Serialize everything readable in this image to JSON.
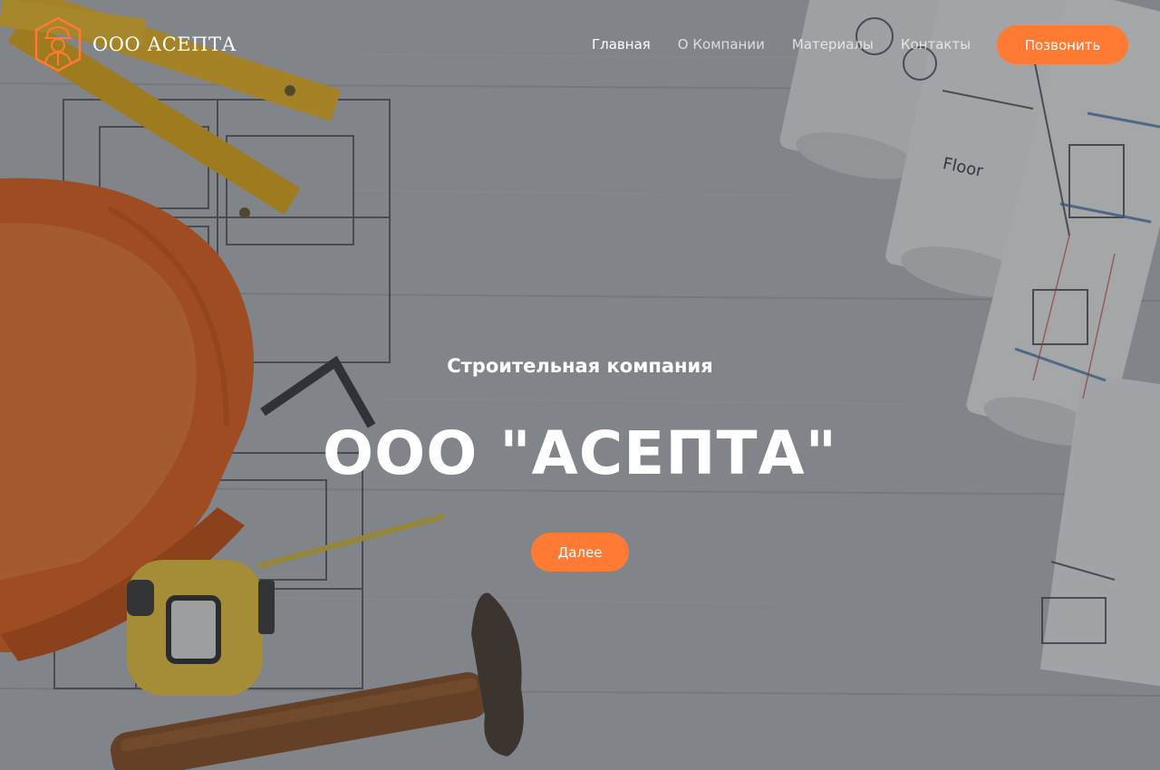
{
  "brand": {
    "name": "ООО АСЕПТА",
    "logo_icon": "worker-helmet-icon",
    "accent_color": "#ff7a33"
  },
  "nav": {
    "items": [
      {
        "label": "Главная",
        "active": true
      },
      {
        "label": "О Компании",
        "active": false
      },
      {
        "label": "Материалы",
        "active": false
      },
      {
        "label": "Контакты",
        "active": false
      }
    ],
    "call_button": "Позвонить"
  },
  "hero": {
    "subtitle": "Строительная компания",
    "title": "ООО \"АСЕПТА\"",
    "button": "Далее",
    "background": "construction-tools-blueprints-image",
    "blueprint_label": "Floor"
  }
}
